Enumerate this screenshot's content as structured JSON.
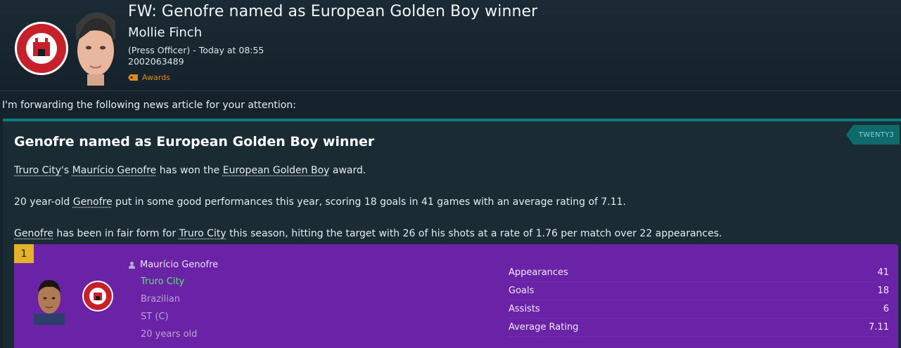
{
  "message": {
    "subject": "FW: Genofre named as European Golden Boy winner",
    "sender": "Mollie Finch",
    "role_time": "(Press Officer) - Today at 08:55",
    "reference": "2002063489",
    "tag": "Awards",
    "tag_icon": "tag-icon",
    "intro": "I'm forwarding the following news article for your attention:"
  },
  "article": {
    "brand": "TWENTY3",
    "headline": "Genofre named as European Golden Boy winner",
    "p1": {
      "club": "Truro City",
      "poss": "'s ",
      "player": "Maurício Genofre",
      "mid": " has won the ",
      "award": "European Golden Boy",
      "end": " award."
    },
    "p2": {
      "pre": "20 year-old ",
      "player": "Genofre",
      "rest": " put in some good performances this year, scoring 18 goals in 41 games with an average rating of 7.11."
    },
    "p3": {
      "player": "Genofre",
      "mid": " has been in fair form for ",
      "club": "Truro City",
      "rest": " this season, hitting the target with 26 of his shots at a rate of 1.76 per match over 22 appearances."
    }
  },
  "player_card": {
    "rank": "1",
    "name": "Maurício Genofre",
    "club": "Truro City",
    "nationality": "Brazilian",
    "position": "ST (C)",
    "age": "20 years old",
    "stats": [
      {
        "label": "Appearances",
        "value": "41"
      },
      {
        "label": "Goals",
        "value": "18"
      },
      {
        "label": "Assists",
        "value": "6"
      },
      {
        "label": "Average Rating",
        "value": "7.11"
      }
    ]
  },
  "colors": {
    "accent_teal": "#0d7a7c",
    "card_purple": "#6a22a6",
    "rank_gold": "#e5b22a",
    "club_green": "#5fe07a",
    "tag_orange": "#e08a1e"
  }
}
